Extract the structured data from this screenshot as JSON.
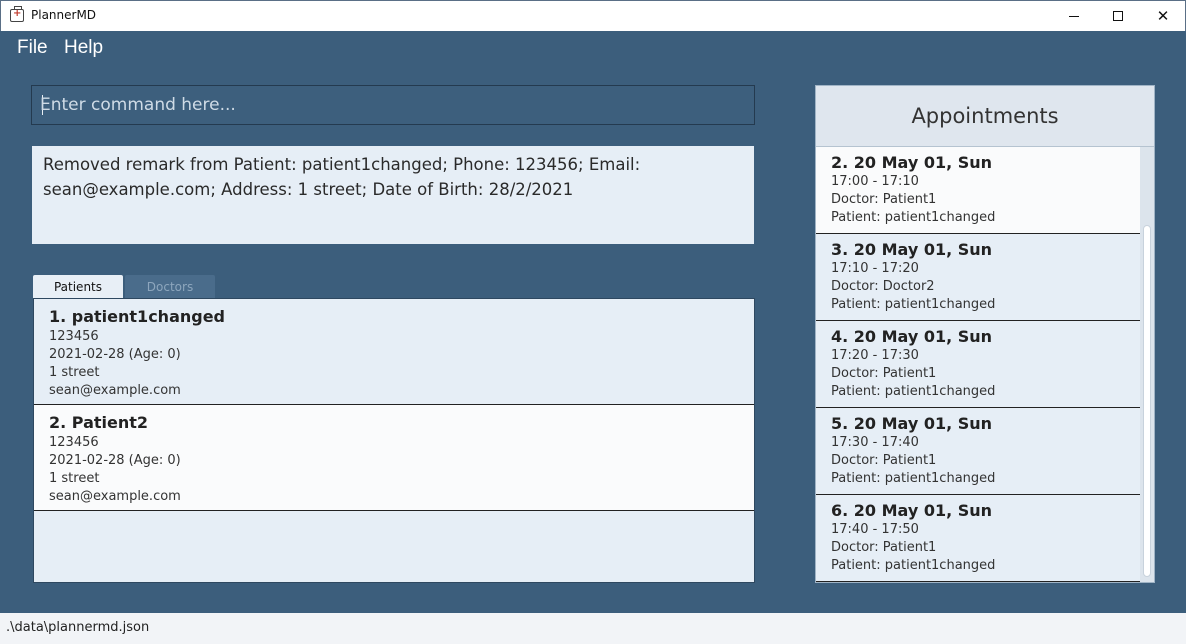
{
  "window": {
    "title": "PlannerMD",
    "icon": "medical-kit-icon",
    "controls": {
      "minimize": "minimize-icon",
      "maximize": "maximize-icon",
      "close": "✕"
    }
  },
  "menu": {
    "file": "File",
    "help": "Help"
  },
  "command": {
    "placeholder": "Enter command here...",
    "value": ""
  },
  "result": {
    "text": "Removed remark from Patient: patient1changed; Phone: 123456; Email: sean@example.com; Address: 1 street; Date of Birth: 28/2/2021"
  },
  "tabs": [
    {
      "label": "Patients",
      "selected": true
    },
    {
      "label": "Doctors",
      "selected": false
    }
  ],
  "patients": [
    {
      "title": "1.  patient1changed",
      "phone": "123456",
      "dob": "2021-02-28 (Age: 0)",
      "address": "1 street",
      "email": "sean@example.com"
    },
    {
      "title": "2.  Patient2",
      "phone": "123456",
      "dob": "2021-02-28 (Age: 0)",
      "address": "1 street",
      "email": "sean@example.com"
    }
  ],
  "appointments": {
    "header": "Appointments",
    "items": [
      {
        "title": "2.  20 May 01, Sun",
        "time": "17:00 - 17:10",
        "doctor": "Doctor: Patient1",
        "patient": "Patient: patient1changed"
      },
      {
        "title": "3.  20 May 01, Sun",
        "time": "17:10 - 17:20",
        "doctor": "Doctor: Doctor2",
        "patient": "Patient: patient1changed"
      },
      {
        "title": "4.  20 May 01, Sun",
        "time": "17:20 - 17:30",
        "doctor": "Doctor: Patient1",
        "patient": "Patient: patient1changed"
      },
      {
        "title": "5.  20 May 01, Sun",
        "time": "17:30 - 17:40",
        "doctor": "Doctor: Patient1",
        "patient": "Patient: patient1changed"
      },
      {
        "title": "6.  20 May 01, Sun",
        "time": "17:40 - 17:50",
        "doctor": "Doctor: Patient1",
        "patient": "Patient: patient1changed"
      }
    ]
  },
  "status": {
    "file_path": ".\\data\\plannermd.json"
  },
  "colors": {
    "background": "#3c5e7c",
    "panel": "#e6eef6",
    "panel_alt": "#fafbfc"
  }
}
